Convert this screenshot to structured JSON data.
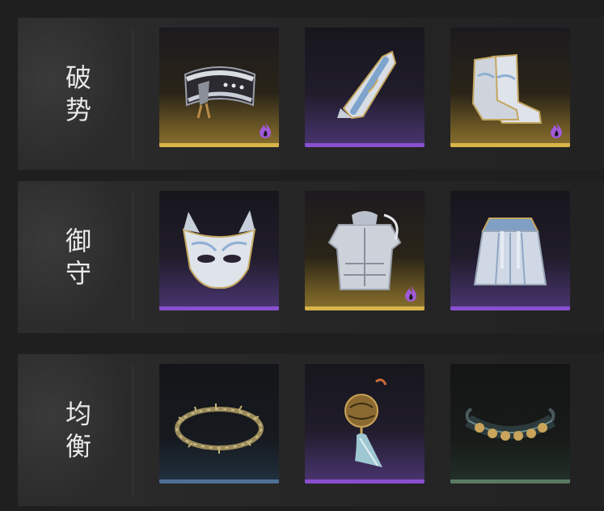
{
  "rows": [
    {
      "label_chars": [
        "破",
        "势"
      ],
      "slots": [
        {
          "icon": "belt-icon",
          "rarity": "gold",
          "flame": true
        },
        {
          "icon": "bracer-icon",
          "rarity": "purple",
          "flame": false
        },
        {
          "icon": "boots-icon",
          "rarity": "gold",
          "flame": true
        }
      ]
    },
    {
      "label_chars": [
        "御",
        "守"
      ],
      "slots": [
        {
          "icon": "mask-icon",
          "rarity": "purple",
          "flame": false
        },
        {
          "icon": "chest-armor-icon",
          "rarity": "gold",
          "flame": true
        },
        {
          "icon": "skirt-armor-icon",
          "rarity": "purple",
          "flame": false
        }
      ]
    },
    {
      "label_chars": [
        "均",
        "衡"
      ],
      "slots": [
        {
          "icon": "thorn-ring-icon",
          "rarity": "blue",
          "flame": false
        },
        {
          "icon": "bell-pendant-icon",
          "rarity": "purple",
          "flame": false
        },
        {
          "icon": "studded-collar-icon",
          "rarity": "green",
          "flame": false
        }
      ]
    }
  ],
  "colors": {
    "gold": "#d8b54a",
    "purple": "#8a4fd0",
    "blue": "#4f6f96",
    "green": "#5b7a63",
    "flame": "#a05ad8"
  }
}
